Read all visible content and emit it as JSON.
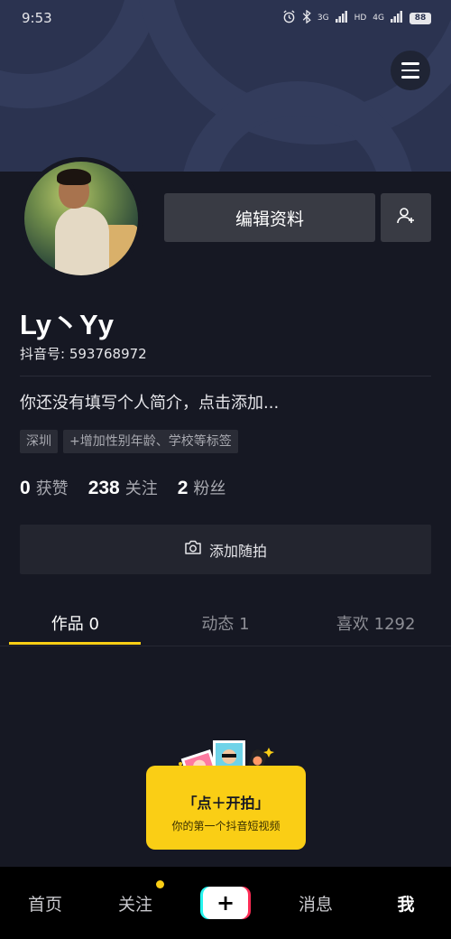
{
  "status_bar": {
    "time": "9:53",
    "network_3g": "3G",
    "network_4g": "4G",
    "hd": "HD",
    "battery": "88"
  },
  "profile": {
    "username": "Ly丶Yy",
    "douyin_id": "抖音号: 593768972",
    "bio_placeholder": "你还没有填写个人简介，点击添加...",
    "edit_button": "编辑资料",
    "tags": {
      "location": "深圳",
      "add_tags": "+增加性别年龄、学校等标签"
    },
    "stats": {
      "likes_count": "0",
      "likes_label": "获赞",
      "following_count": "238",
      "following_label": "关注",
      "followers_count": "2",
      "followers_label": "粉丝"
    },
    "add_moment": "添加随拍"
  },
  "tabs": [
    {
      "label": "作品 0"
    },
    {
      "label": "动态 1"
    },
    {
      "label": "喜欢 1292"
    }
  ],
  "tooltip": {
    "title": "「点＋开拍」",
    "subtitle": "你的第一个抖音短视频"
  },
  "bottom_nav": {
    "home": "首页",
    "following": "关注",
    "plus": "+",
    "messages": "消息",
    "me": "我"
  },
  "colors": {
    "accent": "#face15",
    "background": "#161823",
    "banner": "#2b3350"
  }
}
